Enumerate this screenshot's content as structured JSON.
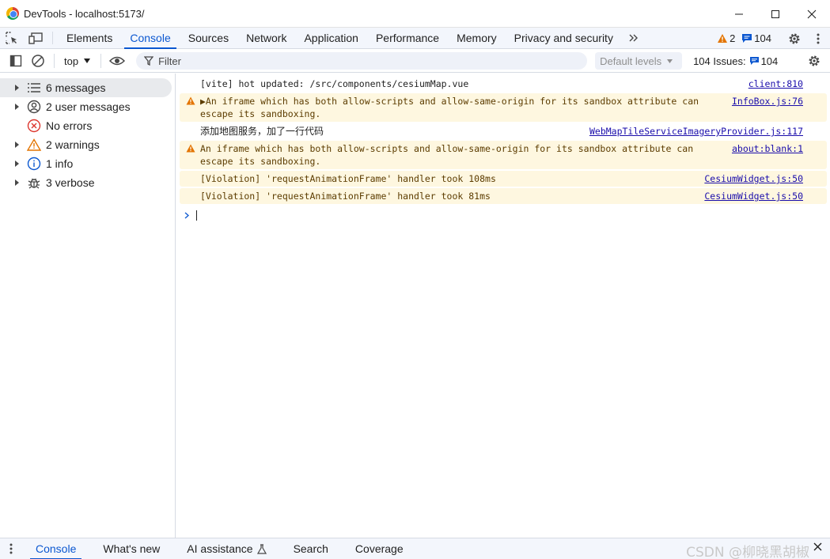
{
  "window": {
    "title": "DevTools - localhost:5173/",
    "controls": [
      "minimize-icon",
      "maximize-icon",
      "close-icon"
    ]
  },
  "tabs": [
    {
      "label": "Elements",
      "active": false
    },
    {
      "label": "Console",
      "active": true
    },
    {
      "label": "Sources",
      "active": false
    },
    {
      "label": "Network",
      "active": false
    },
    {
      "label": "Application",
      "active": false
    },
    {
      "label": "Performance",
      "active": false
    },
    {
      "label": "Memory",
      "active": false
    },
    {
      "label": "Privacy and security",
      "active": false
    }
  ],
  "tab_right": {
    "warnings_count": "2",
    "messages_count": "104"
  },
  "toolbar": {
    "context": "top",
    "filter_placeholder": "Filter",
    "levels": "Default levels",
    "issues_label": "104 Issues:",
    "issues_count": "104"
  },
  "sidebar": {
    "items": [
      {
        "label": "6 messages",
        "icon": "list-icon",
        "expandable": true,
        "selected": true
      },
      {
        "label": "2 user messages",
        "icon": "user-icon",
        "expandable": true,
        "selected": false
      },
      {
        "label": "No errors",
        "icon": "error-icon",
        "expandable": false,
        "selected": false
      },
      {
        "label": "2 warnings",
        "icon": "warning-icon",
        "expandable": true,
        "selected": false
      },
      {
        "label": "1 info",
        "icon": "info-icon",
        "expandable": true,
        "selected": false
      },
      {
        "label": "3 verbose",
        "icon": "bug-icon",
        "expandable": true,
        "selected": false
      }
    ]
  },
  "console": {
    "messages": [
      {
        "level": "log",
        "text": "[vite] hot updated: /src/components/cesiumMap.vue",
        "source": "client:810"
      },
      {
        "level": "warning",
        "text": "▶An iframe which has both allow-scripts and allow-same-origin for its sandbox attribute can escape its sandboxing.",
        "source": "InfoBox.js:76"
      },
      {
        "level": "log",
        "text": "添加地图服务，加了一行代码",
        "source": "WebMapTileServiceImageryProvider.js:117"
      },
      {
        "level": "warning",
        "text": "An iframe which has both allow-scripts and allow-same-origin for its sandbox attribute can escape its sandboxing.",
        "source": "about:blank:1"
      },
      {
        "level": "violation",
        "text": "[Violation] 'requestAnimationFrame' handler took 108ms",
        "source": "CesiumWidget.js:50"
      },
      {
        "level": "violation",
        "text": "[Violation] 'requestAnimationFrame' handler took 81ms",
        "source": "CesiumWidget.js:50"
      }
    ]
  },
  "drawer": {
    "tabs": [
      {
        "label": "Console",
        "active": true
      },
      {
        "label": "What's new",
        "active": false
      },
      {
        "label": "AI assistance",
        "active": false
      },
      {
        "label": "Search",
        "active": false
      },
      {
        "label": "Coverage",
        "active": false
      }
    ]
  },
  "watermark": "CSDN @柳晓黑胡椒",
  "colors": {
    "accent": "#0b57d0",
    "warning_bg": "#fef7e0",
    "warning_icon": "#e37400",
    "error_icon": "#dc362e",
    "link": "#1a0dab"
  }
}
